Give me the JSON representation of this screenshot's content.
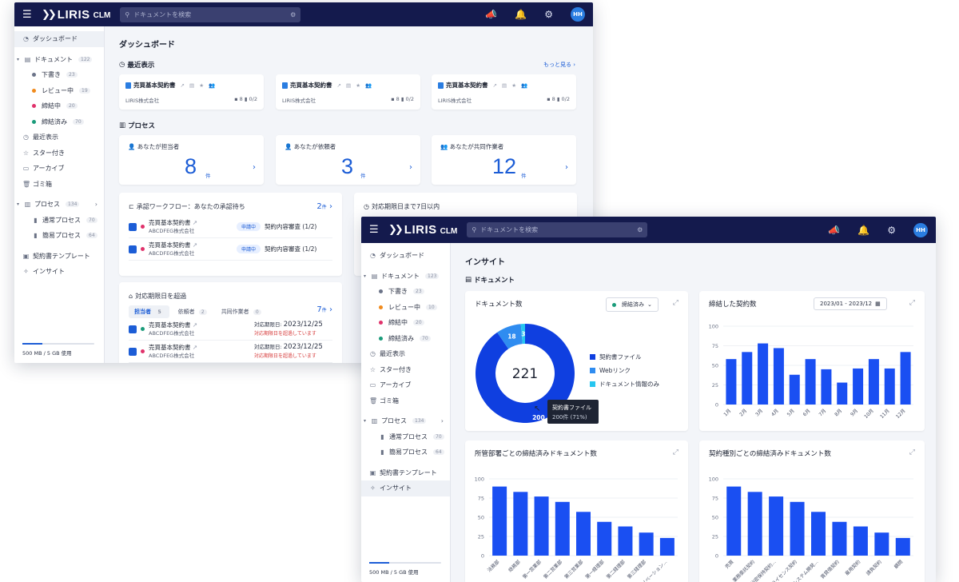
{
  "app": {
    "logo_text": "LIRIS",
    "logo_sub": "CLM",
    "search_placeholder": "ドキュメントを検索",
    "avatar": "HH"
  },
  "sidebar": {
    "dashboard": "ダッシュボード",
    "documents": "ドキュメント",
    "documents_count": "122",
    "documents_count_2": "123",
    "sub_docs": [
      {
        "label": "下書き",
        "count": "23",
        "color": "#6b7388"
      },
      {
        "label": "レビュー中",
        "count": "19",
        "color": "#f08a1c"
      },
      {
        "label": "締結中",
        "count": "20",
        "color": "#e0326b"
      },
      {
        "label": "締結済み",
        "count": "70",
        "color": "#1a9b7a"
      }
    ],
    "sub_docs_2_count_review": "10",
    "recent": "最近表示",
    "starred": "スター付き",
    "archive": "アーカイブ",
    "trash": "ゴミ箱",
    "process": "プロセス",
    "process_count": "134",
    "sub_process": [
      {
        "label": "通常プロセス",
        "count": "70"
      },
      {
        "label": "簡易プロセス",
        "count": "64"
      }
    ],
    "template": "契約書テンプレート",
    "insight": "インサイト",
    "storage": "500 MB / 5 GB 使用"
  },
  "dashboard": {
    "title": "ダッシュボード",
    "recent_title": "最近表示",
    "see_more": "もっと見る",
    "recent_cards": [
      {
        "name": "売買基本契約書",
        "company": "LIRIS株式会社",
        "comments": "8",
        "pages": "0/2"
      },
      {
        "name": "売買基本契約書",
        "company": "LIRIS株式会社",
        "comments": "8",
        "pages": "0/2"
      },
      {
        "name": "売買基本契約書",
        "company": "LIRIS株式会社",
        "comments": "8",
        "pages": "0/2"
      }
    ],
    "process_title": "プロセス",
    "process_cards": [
      {
        "label": "あなたが担当者",
        "value": "8",
        "unit": "件"
      },
      {
        "label": "あなたが依頼者",
        "value": "3",
        "unit": "件"
      },
      {
        "label": "あなたが共同作業者",
        "value": "12",
        "unit": "件"
      }
    ],
    "approval": {
      "title": "承認ワークフロー：あなたの承認待ち",
      "count": "2",
      "unit": "件",
      "rows": [
        {
          "name": "売買基本契約書",
          "company": "ABCDFEG株式会社",
          "badge": "申請中",
          "step": "契約内容審査 (1/2)"
        },
        {
          "name": "売買基本契約書",
          "company": "ABCDFEG株式会社",
          "badge": "申請中",
          "step": "契約内容審査 (1/2)"
        }
      ]
    },
    "due7": {
      "title": "対応期限日まで7日以内"
    },
    "overdue": {
      "title": "対応期限日を超過",
      "count": "7",
      "unit": "件",
      "tabs": [
        {
          "label": "担当者",
          "count": "5"
        },
        {
          "label": "依頼者",
          "count": "2"
        },
        {
          "label": "共同作業者",
          "count": "0"
        }
      ],
      "rows": [
        {
          "name": "売買基本契約書",
          "company": "ABCDFEG株式会社",
          "due_label": "対応期限日: ",
          "due_date": "2023/12/25",
          "warn": "対応期限日を超過しています",
          "dot": "#1a9b7a"
        },
        {
          "name": "売買基本契約書",
          "company": "ABCDFEG株式会社",
          "due_label": "対応期限日: ",
          "due_date": "2023/12/25",
          "warn": "対応期限日を超過しています",
          "dot": "#e0326b"
        }
      ]
    }
  },
  "insight": {
    "title": "インサイト",
    "section": "ドキュメント",
    "donut_title": "ドキュメント数",
    "donut_filter": "締結済み",
    "donut_total": "221",
    "tooltip_title": "契約書ファイル",
    "tooltip_value": "200件 (71%)",
    "bar1_title": "締結した契約数",
    "date_range": "2023/01 - 2023/12",
    "bar2_title": "所管部署ごとの締結済みドキュメント数",
    "bar3_title": "契約種別ごとの締結済みドキュメント数"
  },
  "chart_data": [
    {
      "type": "pie",
      "title": "ドキュメント数",
      "categories": [
        "契約書ファイル",
        "Webリンク",
        "ドキュメント情報のみ"
      ],
      "values": [
        200,
        18,
        3
      ],
      "colors": [
        "#0f3fe0",
        "#2f8cf0",
        "#26c6f0"
      ],
      "total": "221"
    },
    {
      "type": "bar",
      "title": "締結した契約数",
      "categories": [
        "1月",
        "2月",
        "3月",
        "4月",
        "5月",
        "6月",
        "7月",
        "8月",
        "9月",
        "10月",
        "11月",
        "12月"
      ],
      "values": [
        58,
        67,
        78,
        72,
        38,
        58,
        45,
        28,
        46,
        58,
        46,
        67
      ],
      "ylim": [
        0,
        100
      ],
      "yticks": [
        0,
        25,
        50,
        75,
        100
      ],
      "color": "#1a4ff2"
    },
    {
      "type": "bar",
      "title": "所管部署ごとの締結済みドキュメント数",
      "categories": [
        "法務部",
        "総務部",
        "第一営業部",
        "第二営業部",
        "第三営業部",
        "第一経理部",
        "第二経理部",
        "第三経理部",
        "イノベーション..."
      ],
      "values": [
        90,
        83,
        77,
        70,
        57,
        44,
        38,
        30,
        23
      ],
      "ylim": [
        0,
        100
      ],
      "yticks": [
        0,
        25,
        50,
        75,
        100
      ],
      "color": "#1a4ff2"
    },
    {
      "type": "bar",
      "title": "契約種別ごとの締結済みドキュメント数",
      "categories": [
        "売買",
        "業務委託契約",
        "秘密保持契約...",
        "ライセンス契約",
        "システム開発...",
        "賃貸借契約",
        "雇用契約",
        "請負契約",
        "顧問"
      ],
      "values": [
        90,
        83,
        77,
        70,
        57,
        44,
        38,
        30,
        23
      ],
      "ylim": [
        0,
        100
      ],
      "yticks": [
        0,
        25,
        50,
        75,
        100
      ],
      "color": "#1a4ff2"
    }
  ]
}
